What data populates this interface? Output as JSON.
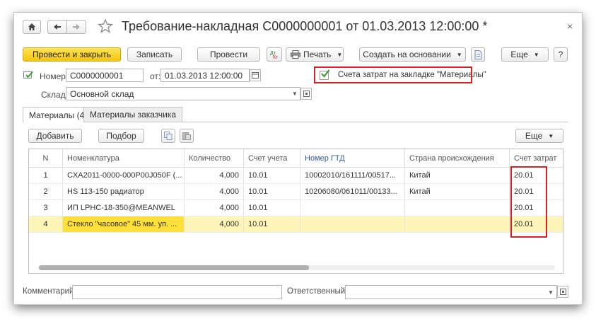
{
  "title": "Требование-накладная С0000000001 от 01.03.2013 12:00:00 *",
  "toolbar": {
    "post_and_close": "Провести и закрыть",
    "save": "Записать",
    "post": "Провести",
    "print": "Печать",
    "create_based_on": "Создать на основании",
    "more": "Еще",
    "help": "?"
  },
  "header": {
    "number_label": "Номер:",
    "number_value": "С0000000001",
    "date_label": "от:",
    "date_value": "01.03.2013 12:00:00",
    "checkbox_label": "Счета затрат на закладке \"Материалы\"",
    "checkbox_checked": true,
    "warehouse_label": "Склад:",
    "warehouse_value": "Основной склад"
  },
  "tabs": [
    {
      "label": "Материалы (4)",
      "active": true
    },
    {
      "label": "Материалы заказчика",
      "active": false
    }
  ],
  "table_toolbar": {
    "add": "Добавить",
    "pick": "Подбор",
    "more": "Еще"
  },
  "table": {
    "columns": [
      "N",
      "Номенклатура",
      "Количество",
      "Счет учета",
      "Номер ГТД",
      "Страна происхождения",
      "Счет затрат"
    ],
    "rows": [
      {
        "n": "1",
        "item": "CXA2011-0000-000P00J050F (...",
        "qty": "4,000",
        "account": "10.01",
        "gtd": "10002010/161111/00517...",
        "country": "Китай",
        "cost_account": "20.01"
      },
      {
        "n": "2",
        "item": "HS 113-150 радиатор",
        "qty": "4,000",
        "account": "10.01",
        "gtd": "10206080/061011/00133...",
        "country": "Китай",
        "cost_account": "20.01"
      },
      {
        "n": "3",
        "item": "ИП LPHC-18-350@MEANWEL",
        "qty": "4,000",
        "account": "10.01",
        "gtd": "",
        "country": "",
        "cost_account": "20.01"
      },
      {
        "n": "4",
        "item": "Стекло \"часовое\" 45 мм. уп. ...",
        "qty": "4,000",
        "account": "10.01",
        "gtd": "",
        "country": "",
        "cost_account": "20.01"
      }
    ]
  },
  "footer": {
    "comment_label": "Комментарий:",
    "comment_value": "",
    "responsible_label": "Ответственный:",
    "responsible_value": ""
  },
  "colors": {
    "primary_button": "#f4c50c",
    "selected_row": "#fff5b8",
    "selected_cell": "#ffdf3a",
    "highlight_box": "#e02020",
    "checkbox_tick": "#2a9a2a"
  }
}
